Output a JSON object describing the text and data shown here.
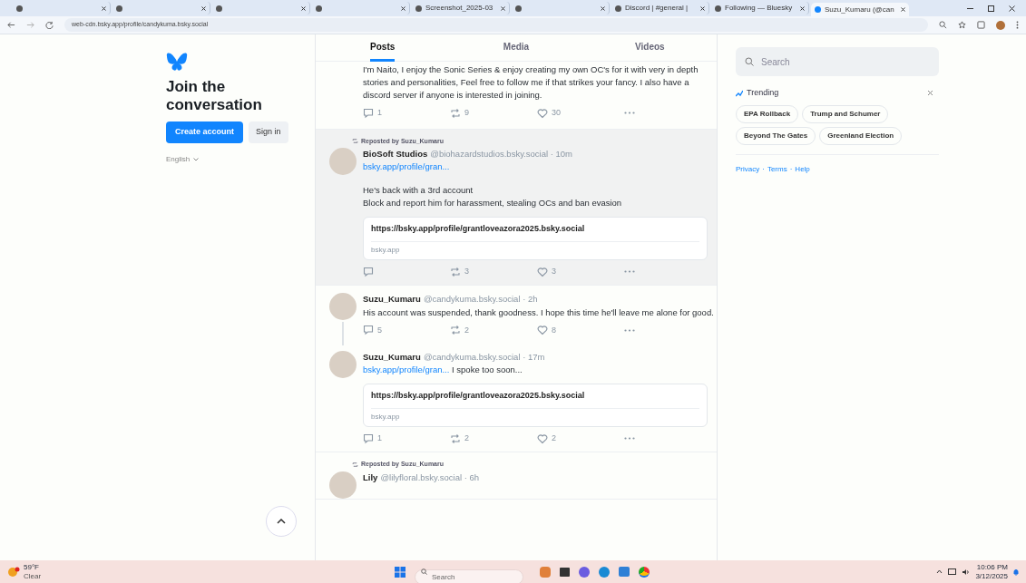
{
  "browser": {
    "tabs": [
      {
        "selected": false
      },
      {
        "selected": false
      },
      {
        "selected": false
      },
      {
        "selected": false
      },
      {
        "title": "Screenshot_2025-03",
        "selected": false
      },
      {
        "selected": false
      },
      {
        "title": "Discord | #general |",
        "selected": false
      },
      {
        "title": "Following — Bluesky",
        "selected": false
      },
      {
        "title": "Suzu_Kumaru (@can",
        "selected": true
      }
    ],
    "url": "web-cdn.bsky.app/profile/candykuma.bsky.social"
  },
  "sidebar": {
    "heading": "Join the conversation",
    "create_button": "Create account",
    "sign_in_button": "Sign in",
    "language": "English"
  },
  "feed": {
    "tabs": [
      {
        "label": "Posts",
        "selected": true
      },
      {
        "label": "Media",
        "selected": false
      },
      {
        "label": "Videos",
        "selected": false
      }
    ],
    "posts": [
      {
        "kind": "continuation",
        "highlighted": false,
        "text": "I'm Naito, I enjoy the Sonic Series & enjoy creating my own OC's for it with very in depth stories and personalities, Feel free to follow me if that strikes your fancy. I also have a discord server if anyone is interested in joining.",
        "actions": {
          "replies": "1",
          "reposts": "9",
          "likes": "30"
        }
      },
      {
        "kind": "post",
        "highlighted": true,
        "reposted_by": "Reposted by Suzu_Kumaru",
        "author": "BioSoft Studios",
        "handle": "@biohazardstudios.bsky.social · 10m",
        "link": "bsky.app/profile/gran...",
        "link_inline": false,
        "text": "He's back with a 3rd account\nBlock and report him for harassment, stealing OCs and ban evasion",
        "card": {
          "url": "https://bsky.app/profile/grantloveazora2025.bsky.social",
          "domain": "bsky.app"
        },
        "thread_line": false,
        "actions": {
          "reposts": "3",
          "likes": "3"
        }
      },
      {
        "kind": "post",
        "highlighted": false,
        "author": "Suzu_Kumaru",
        "handle": "@candykuma.bsky.social · 2h",
        "text": "His account was suspended, thank goodness. I hope this time he'll leave me alone for good.",
        "thread_line": true,
        "actions": {
          "replies": "5",
          "reposts": "2",
          "likes": "8"
        }
      },
      {
        "kind": "post",
        "highlighted": false,
        "author": "Suzu_Kumaru",
        "handle": "@candykuma.bsky.social · 17m",
        "link": "bsky.app/profile/gran...",
        "link_inline": true,
        "text": "I spoke too soon...",
        "card": {
          "url": "https://bsky.app/profile/grantloveazora2025.bsky.social",
          "domain": "bsky.app"
        },
        "thread_line": false,
        "actions": {
          "replies": "1",
          "reposts": "2",
          "likes": "2"
        }
      },
      {
        "kind": "partial",
        "highlighted": false,
        "reposted_by": "Reposted by Suzu_Kumaru",
        "author": "Lily",
        "handle": "@lilyfloral.bsky.social · 6h"
      }
    ]
  },
  "right": {
    "search_placeholder": "Search",
    "trending_title": "Trending",
    "topics": [
      "EPA Rollback",
      "Trump and Schumer",
      "Beyond The Gates",
      "Greenland Election"
    ],
    "footer_links": [
      "Privacy",
      "Terms",
      "Help"
    ],
    "footer_separator": "·"
  },
  "taskbar": {
    "temperature": "59°F",
    "condition": "Clear",
    "search_placeholder": "Search",
    "time": "10:06 PM",
    "date": "3/12/2025"
  }
}
